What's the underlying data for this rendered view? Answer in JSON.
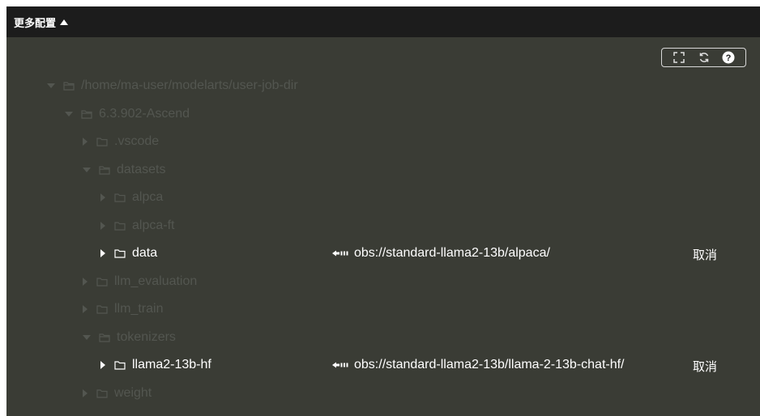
{
  "header": {
    "title": "更多配置"
  },
  "tree": [
    {
      "label": "/home/ma-user/modelarts/user-job-dir",
      "expanded": true,
      "level": 0,
      "highlight": false
    },
    {
      "label": "6.3.902-Ascend",
      "expanded": true,
      "level": 1,
      "highlight": false
    },
    {
      "label": ".vscode",
      "expanded": false,
      "level": 2,
      "highlight": false
    },
    {
      "label": "datasets",
      "expanded": true,
      "level": 2,
      "highlight": false
    },
    {
      "label": "alpca",
      "expanded": false,
      "level": 3,
      "highlight": false
    },
    {
      "label": "alpca-ft",
      "expanded": false,
      "level": 3,
      "highlight": false
    },
    {
      "label": "data",
      "expanded": false,
      "level": 3,
      "highlight": true
    },
    {
      "label": "llm_evaluation",
      "expanded": false,
      "level": 2,
      "highlight": false
    },
    {
      "label": "llm_train",
      "expanded": false,
      "level": 2,
      "highlight": false
    },
    {
      "label": "tokenizers",
      "expanded": true,
      "level": 2,
      "highlight": false
    },
    {
      "label": "llama2-13b-hf",
      "expanded": false,
      "level": 3,
      "highlight": true
    },
    {
      "label": "weight",
      "expanded": false,
      "level": 2,
      "highlight": false
    }
  ],
  "mappings": [
    {
      "row": 6,
      "path": "obs://standard-llama2-13b/alpaca/",
      "cancel": "取消"
    },
    {
      "row": 10,
      "path": "obs://standard-llama2-13b/llama-2-13b-chat-hf/",
      "cancel": "取消"
    }
  ],
  "toolbar": {
    "icons": [
      "fullscreen-icon",
      "refresh-icon",
      "help-icon"
    ]
  },
  "colors": {
    "header_bg": "#1c1c1c",
    "panel_bg": "#3a3c35",
    "dim_text": "#535650",
    "lit_text": "#ffffff"
  }
}
